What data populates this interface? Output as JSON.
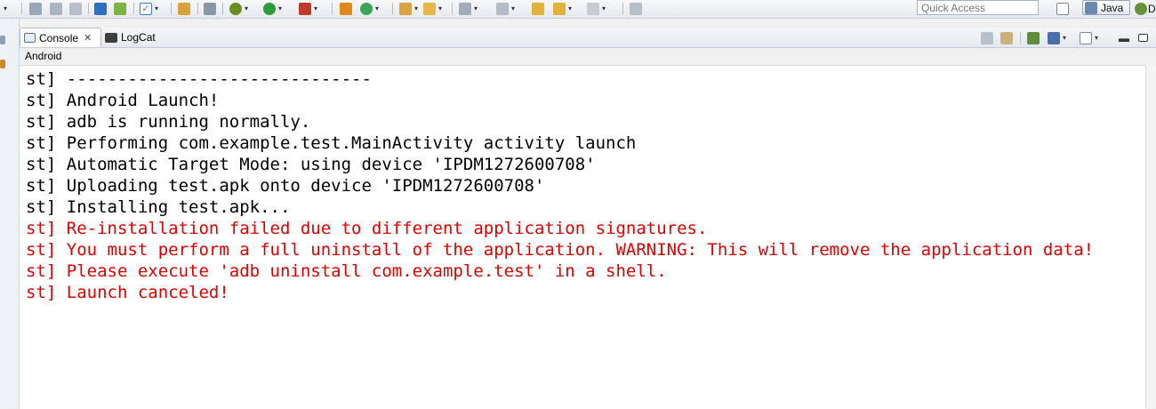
{
  "toolbar": {
    "quick_access_placeholder": "Quick Access",
    "perspective_label": "Java",
    "trailing_letter": "D"
  },
  "views": {
    "tabs": [
      {
        "label": "Console",
        "icon": "console-icon",
        "active": true
      },
      {
        "label": "LogCat",
        "icon": "logcat-icon",
        "active": false
      }
    ],
    "panel_title": "Android"
  },
  "console": {
    "colors": {
      "info": "#000000",
      "error": "#e00000"
    },
    "lines": [
      {
        "text": "st] ------------------------------",
        "level": "info"
      },
      {
        "text": "st] Android Launch!",
        "level": "info"
      },
      {
        "text": "st] adb is running normally.",
        "level": "info"
      },
      {
        "text": "st] Performing com.example.test.MainActivity activity launch",
        "level": "info"
      },
      {
        "text": "st] Automatic Target Mode: using device 'IPDM1272600708'",
        "level": "info"
      },
      {
        "text": "st] Uploading test.apk onto device 'IPDM1272600708'",
        "level": "info"
      },
      {
        "text": "st] Installing test.apk...",
        "level": "info"
      },
      {
        "text": "st] Re-installation failed due to different application signatures.",
        "level": "error"
      },
      {
        "text": "st] You must perform a full uninstall of the application. WARNING: This will remove the application data!",
        "level": "error"
      },
      {
        "text": "st] Please execute 'adb uninstall com.example.test' in a shell.",
        "level": "error"
      },
      {
        "text": "st] Launch canceled!",
        "level": "error"
      }
    ]
  }
}
